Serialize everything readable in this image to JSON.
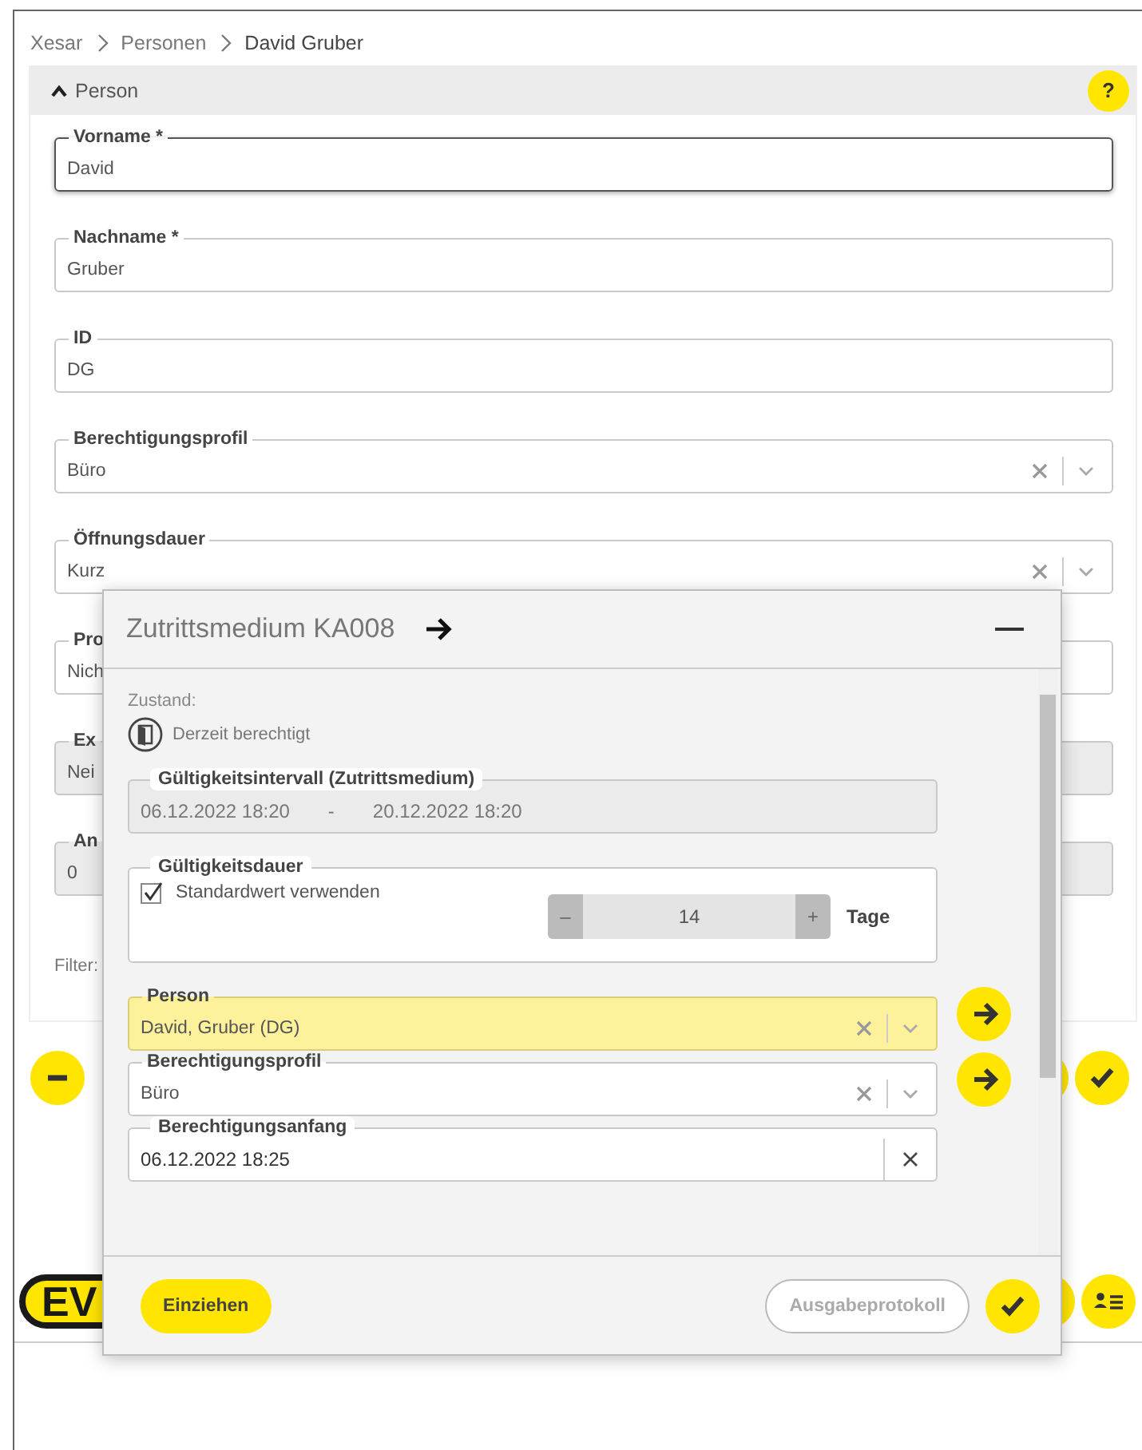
{
  "breadcrumb": [
    {
      "label": "Xesar",
      "current": false
    },
    {
      "label": "Personen",
      "current": false
    },
    {
      "label": "David Gruber",
      "current": true
    }
  ],
  "panel": {
    "title": "Person",
    "expanded": true,
    "help": "?",
    "fields": [
      {
        "label": "Vorname *",
        "value": "David",
        "kind": "text",
        "focused": true,
        "disabled": false
      },
      {
        "label": "Nachname *",
        "value": "Gruber",
        "kind": "text",
        "focused": false,
        "disabled": false
      },
      {
        "label": "ID",
        "value": "DG",
        "kind": "text",
        "focused": false,
        "disabled": false
      },
      {
        "label": "Berechtigungsprofil",
        "value": "Büro",
        "kind": "select",
        "focused": false,
        "disabled": false
      },
      {
        "label": "Öffnungsdauer",
        "value": "Kurz",
        "kind": "select",
        "focused": false,
        "disabled": false
      },
      {
        "label": "Pro",
        "value": "Nich",
        "kind": "text",
        "focused": false,
        "disabled": false
      },
      {
        "label": "Ex",
        "value": "Nei",
        "kind": "text",
        "focused": false,
        "disabled": true
      },
      {
        "label": "An",
        "value": "0",
        "kind": "text",
        "focused": false,
        "disabled": true
      }
    ],
    "filter_label": "Filter:"
  },
  "logo": "EV",
  "dialog": {
    "title": "Zutrittsmedium KA008",
    "state_label": "Zustand:",
    "state": "Derzeit berechtigt",
    "interval": {
      "label": "Gültigkeitsintervall (Zutrittsmedium)",
      "from": "06.12.2022 18:20",
      "separator": "-",
      "to": "20.12.2022 18:20"
    },
    "duration": {
      "label": "Gültigkeitsdauer",
      "checkbox": {
        "label": "Standardwert verwenden",
        "checked": true
      },
      "minus": "–",
      "value": "14",
      "plus": "+",
      "unit": "Tage"
    },
    "selects": [
      {
        "label": "Person",
        "value": "David, Gruber (DG)",
        "highlighted": true
      },
      {
        "label": "Berechtigungsprofil",
        "value": "Büro",
        "highlighted": false
      }
    ],
    "date_field": {
      "label": "Berechtigungsanfang",
      "value": "06.12.2022 18:25"
    },
    "buttons": [
      {
        "label": "Einziehen",
        "kind": "primary",
        "disabled": false
      },
      {
        "label": "Ausgabeprotokoll",
        "kind": "outline",
        "disabled": true
      }
    ]
  }
}
